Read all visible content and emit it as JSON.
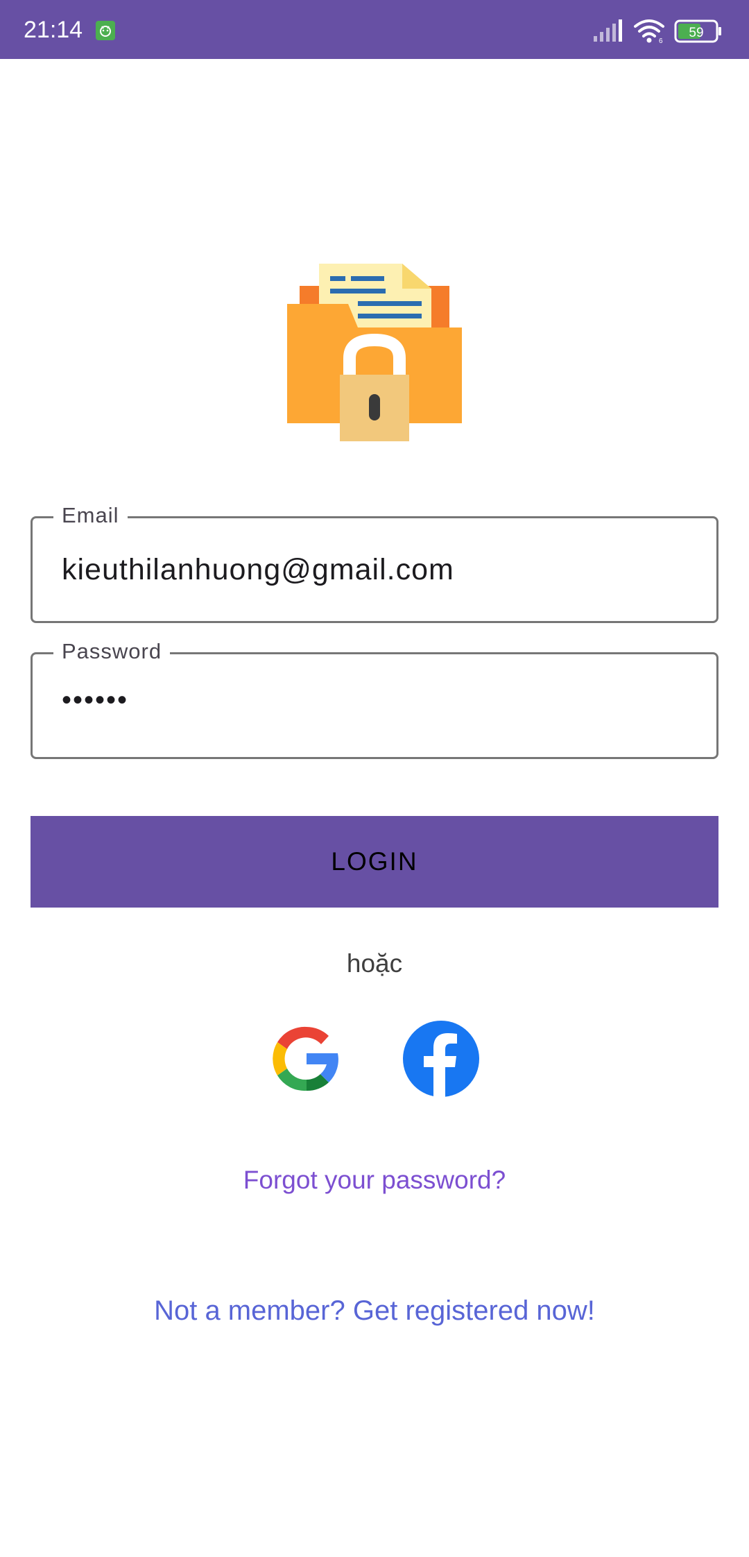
{
  "status_bar": {
    "time": "21:14",
    "battery_level": "59",
    "icons": [
      "app-notification-icon",
      "signal-icon",
      "wifi-icon",
      "battery-icon"
    ],
    "background_color": "#6750a4"
  },
  "logo": {
    "icon": "locked-folder-icon"
  },
  "form": {
    "email": {
      "label": "Email",
      "value": "kieuthilanhuong@gmail.com"
    },
    "password": {
      "label": "Password",
      "value": "••••••"
    },
    "login_label": "LOGIN"
  },
  "social": {
    "or_text": "hoặc",
    "providers": [
      "google-icon",
      "facebook-icon"
    ]
  },
  "links": {
    "forgot_password": "Forgot your password?",
    "register": "Not a member? Get registered now!"
  },
  "colors": {
    "accent": "#6750a4",
    "link_forgot": "#7c4fd1",
    "link_register": "#5865d6",
    "field_border": "#767676"
  }
}
